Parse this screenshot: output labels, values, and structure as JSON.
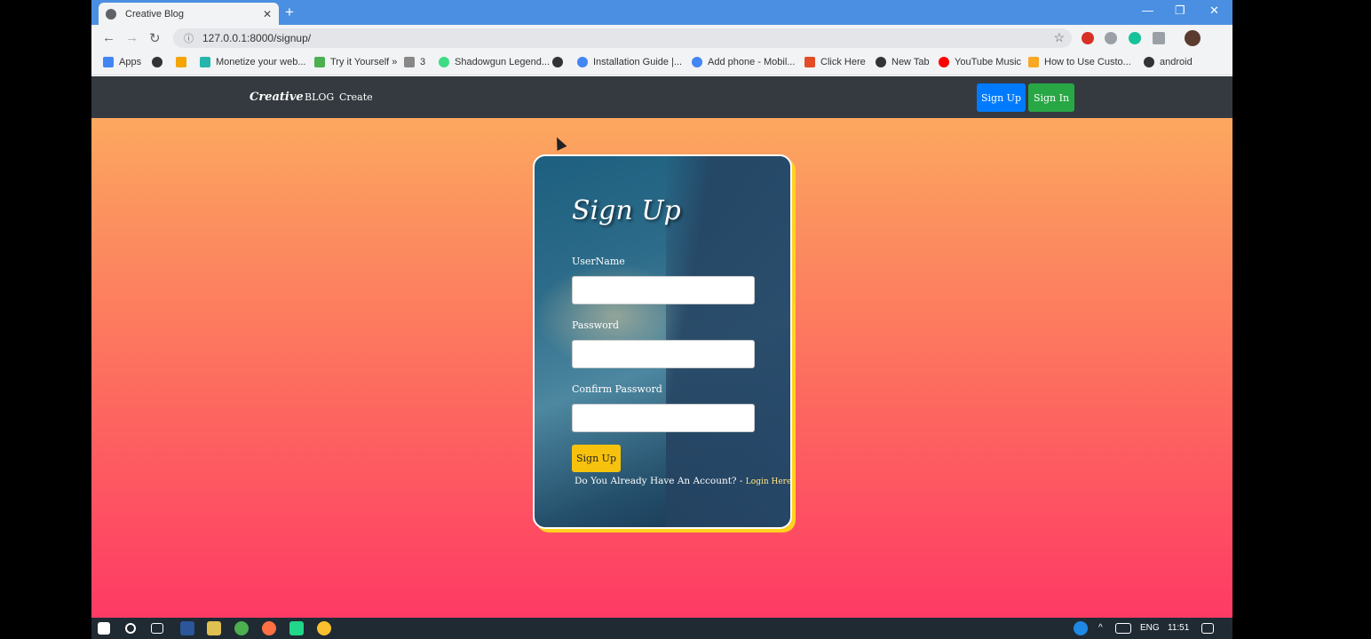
{
  "browser": {
    "tab_title": "Creative Blog",
    "tab_close": "✕",
    "new_tab": "+",
    "url": "127.0.0.1:8000/signup/",
    "window_controls": {
      "minimize": "—",
      "restore": "❐",
      "close": "✕"
    }
  },
  "bookmarks": [
    {
      "label": "Apps",
      "icon": "apps-icon",
      "color": "#4285f4"
    },
    {
      "label": "",
      "icon": "globe-icon",
      "color": "#333333"
    },
    {
      "label": "",
      "icon": "cp-icon",
      "color": "#f4a300"
    },
    {
      "label": "Monetize your web...",
      "icon": "monetize-icon",
      "color": "#26b5ab"
    },
    {
      "label": "Try it Yourself »",
      "icon": "w3-icon",
      "color": "#4caf50"
    },
    {
      "label": "3",
      "icon": "k-icon",
      "color": "#888888"
    },
    {
      "label": "Shadowgun Legend...",
      "icon": "android-icon",
      "color": "#3ddc84"
    },
    {
      "label": "",
      "icon": "globe-icon",
      "color": "#333333"
    },
    {
      "label": "Installation Guide |...",
      "icon": "guide-icon",
      "color": "#4285f4"
    },
    {
      "label": "Add phone - Mobil...",
      "icon": "phone-icon",
      "color": "#4285f4"
    },
    {
      "label": "Click Here",
      "icon": "hat-icon",
      "color": "#e34c26"
    },
    {
      "label": "New Tab",
      "icon": "globe-icon",
      "color": "#333333"
    },
    {
      "label": "YouTube Music",
      "icon": "youtube-music-icon",
      "color": "#ff0000"
    },
    {
      "label": "How to Use Custo...",
      "icon": "flash-icon",
      "color": "#f9a825"
    },
    {
      "label": "android",
      "icon": "globe-icon",
      "color": "#333333"
    }
  ],
  "navbar": {
    "brand": "Creative",
    "links": [
      "BLOG",
      "Create"
    ],
    "signup_label": "Sign Up",
    "signin_label": "Sign In"
  },
  "form": {
    "title": "Sign Up",
    "username_label": "UserName",
    "username_value": "",
    "password_label": "Password",
    "password_value": "",
    "confirm_label": "Confirm Password",
    "confirm_value": "",
    "submit_label": "Sign Up",
    "footer_text": "Do You Already Have An Account? - ",
    "footer_link": "Login Here"
  },
  "taskbar": {
    "language": "ENG",
    "time": "11:51"
  },
  "colors": {
    "navbar_bg": "#343a40",
    "signup_btn": "#007bff",
    "signin_btn": "#28a745",
    "submit_btn": "#f7c20d",
    "card_shadow": "#ffd21f"
  }
}
